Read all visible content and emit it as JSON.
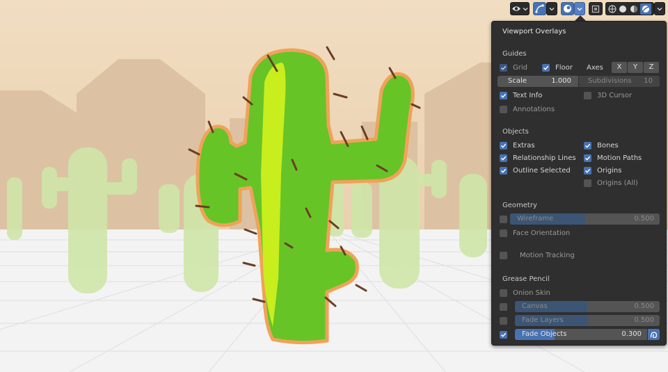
{
  "header": {
    "visibility_icon": "eye-icon",
    "gizmo_icon": "gizmo-icon",
    "overlays_icon": "overlays-icon",
    "xray_icon": "xray-icon",
    "shading_icons": [
      "wireframe-shading-icon",
      "solid-shading-icon",
      "material-shading-icon",
      "rendered-shading-icon"
    ]
  },
  "panel": {
    "title": "Viewport Overlays",
    "guides": {
      "heading": "Guides",
      "grid": {
        "label": "Grid",
        "checked": true
      },
      "floor": {
        "label": "Floor",
        "checked": true
      },
      "axes_label": "Axes",
      "axes": [
        "X",
        "Y",
        "Z"
      ],
      "scale": {
        "label": "Scale",
        "value": "1.000"
      },
      "subdivisions": {
        "label": "Subdivisions",
        "value": "10"
      },
      "text_info": {
        "label": "Text Info",
        "checked": true
      },
      "cursor_3d": {
        "label": "3D Cursor",
        "checked": false
      },
      "annotations": {
        "label": "Annotations",
        "checked": false
      }
    },
    "objects": {
      "heading": "Objects",
      "extras": {
        "label": "Extras",
        "checked": true
      },
      "bones": {
        "label": "Bones",
        "checked": true
      },
      "relationship_lines": {
        "label": "Relationship Lines",
        "checked": true
      },
      "motion_paths": {
        "label": "Motion Paths",
        "checked": true
      },
      "outline_selected": {
        "label": "Outline Selected",
        "checked": true
      },
      "origins": {
        "label": "Origins",
        "checked": true
      },
      "origins_all": {
        "label": "Origins (All)",
        "checked": false
      }
    },
    "geometry": {
      "heading": "Geometry",
      "wireframe": {
        "label": "Wireframe",
        "value": "0.500",
        "fraction": 0.5,
        "checked": false
      },
      "face_orientation": {
        "label": "Face Orientation",
        "checked": false
      }
    },
    "motion_tracking": {
      "label": "Motion Tracking",
      "checked": false
    },
    "grease_pencil": {
      "heading": "Grease Pencil",
      "onion_skin": {
        "label": "Onion Skin",
        "checked": false
      },
      "canvas": {
        "label": "Canvas",
        "value": "0.500",
        "fraction": 0.5,
        "checked": false
      },
      "fade_layers": {
        "label": "Fade Layers",
        "value": "0.500",
        "fraction": 0.5,
        "checked": false
      },
      "fade_objects": {
        "label": "Fade Objects",
        "value": "0.300",
        "fraction": 0.3,
        "checked": true
      }
    }
  }
}
